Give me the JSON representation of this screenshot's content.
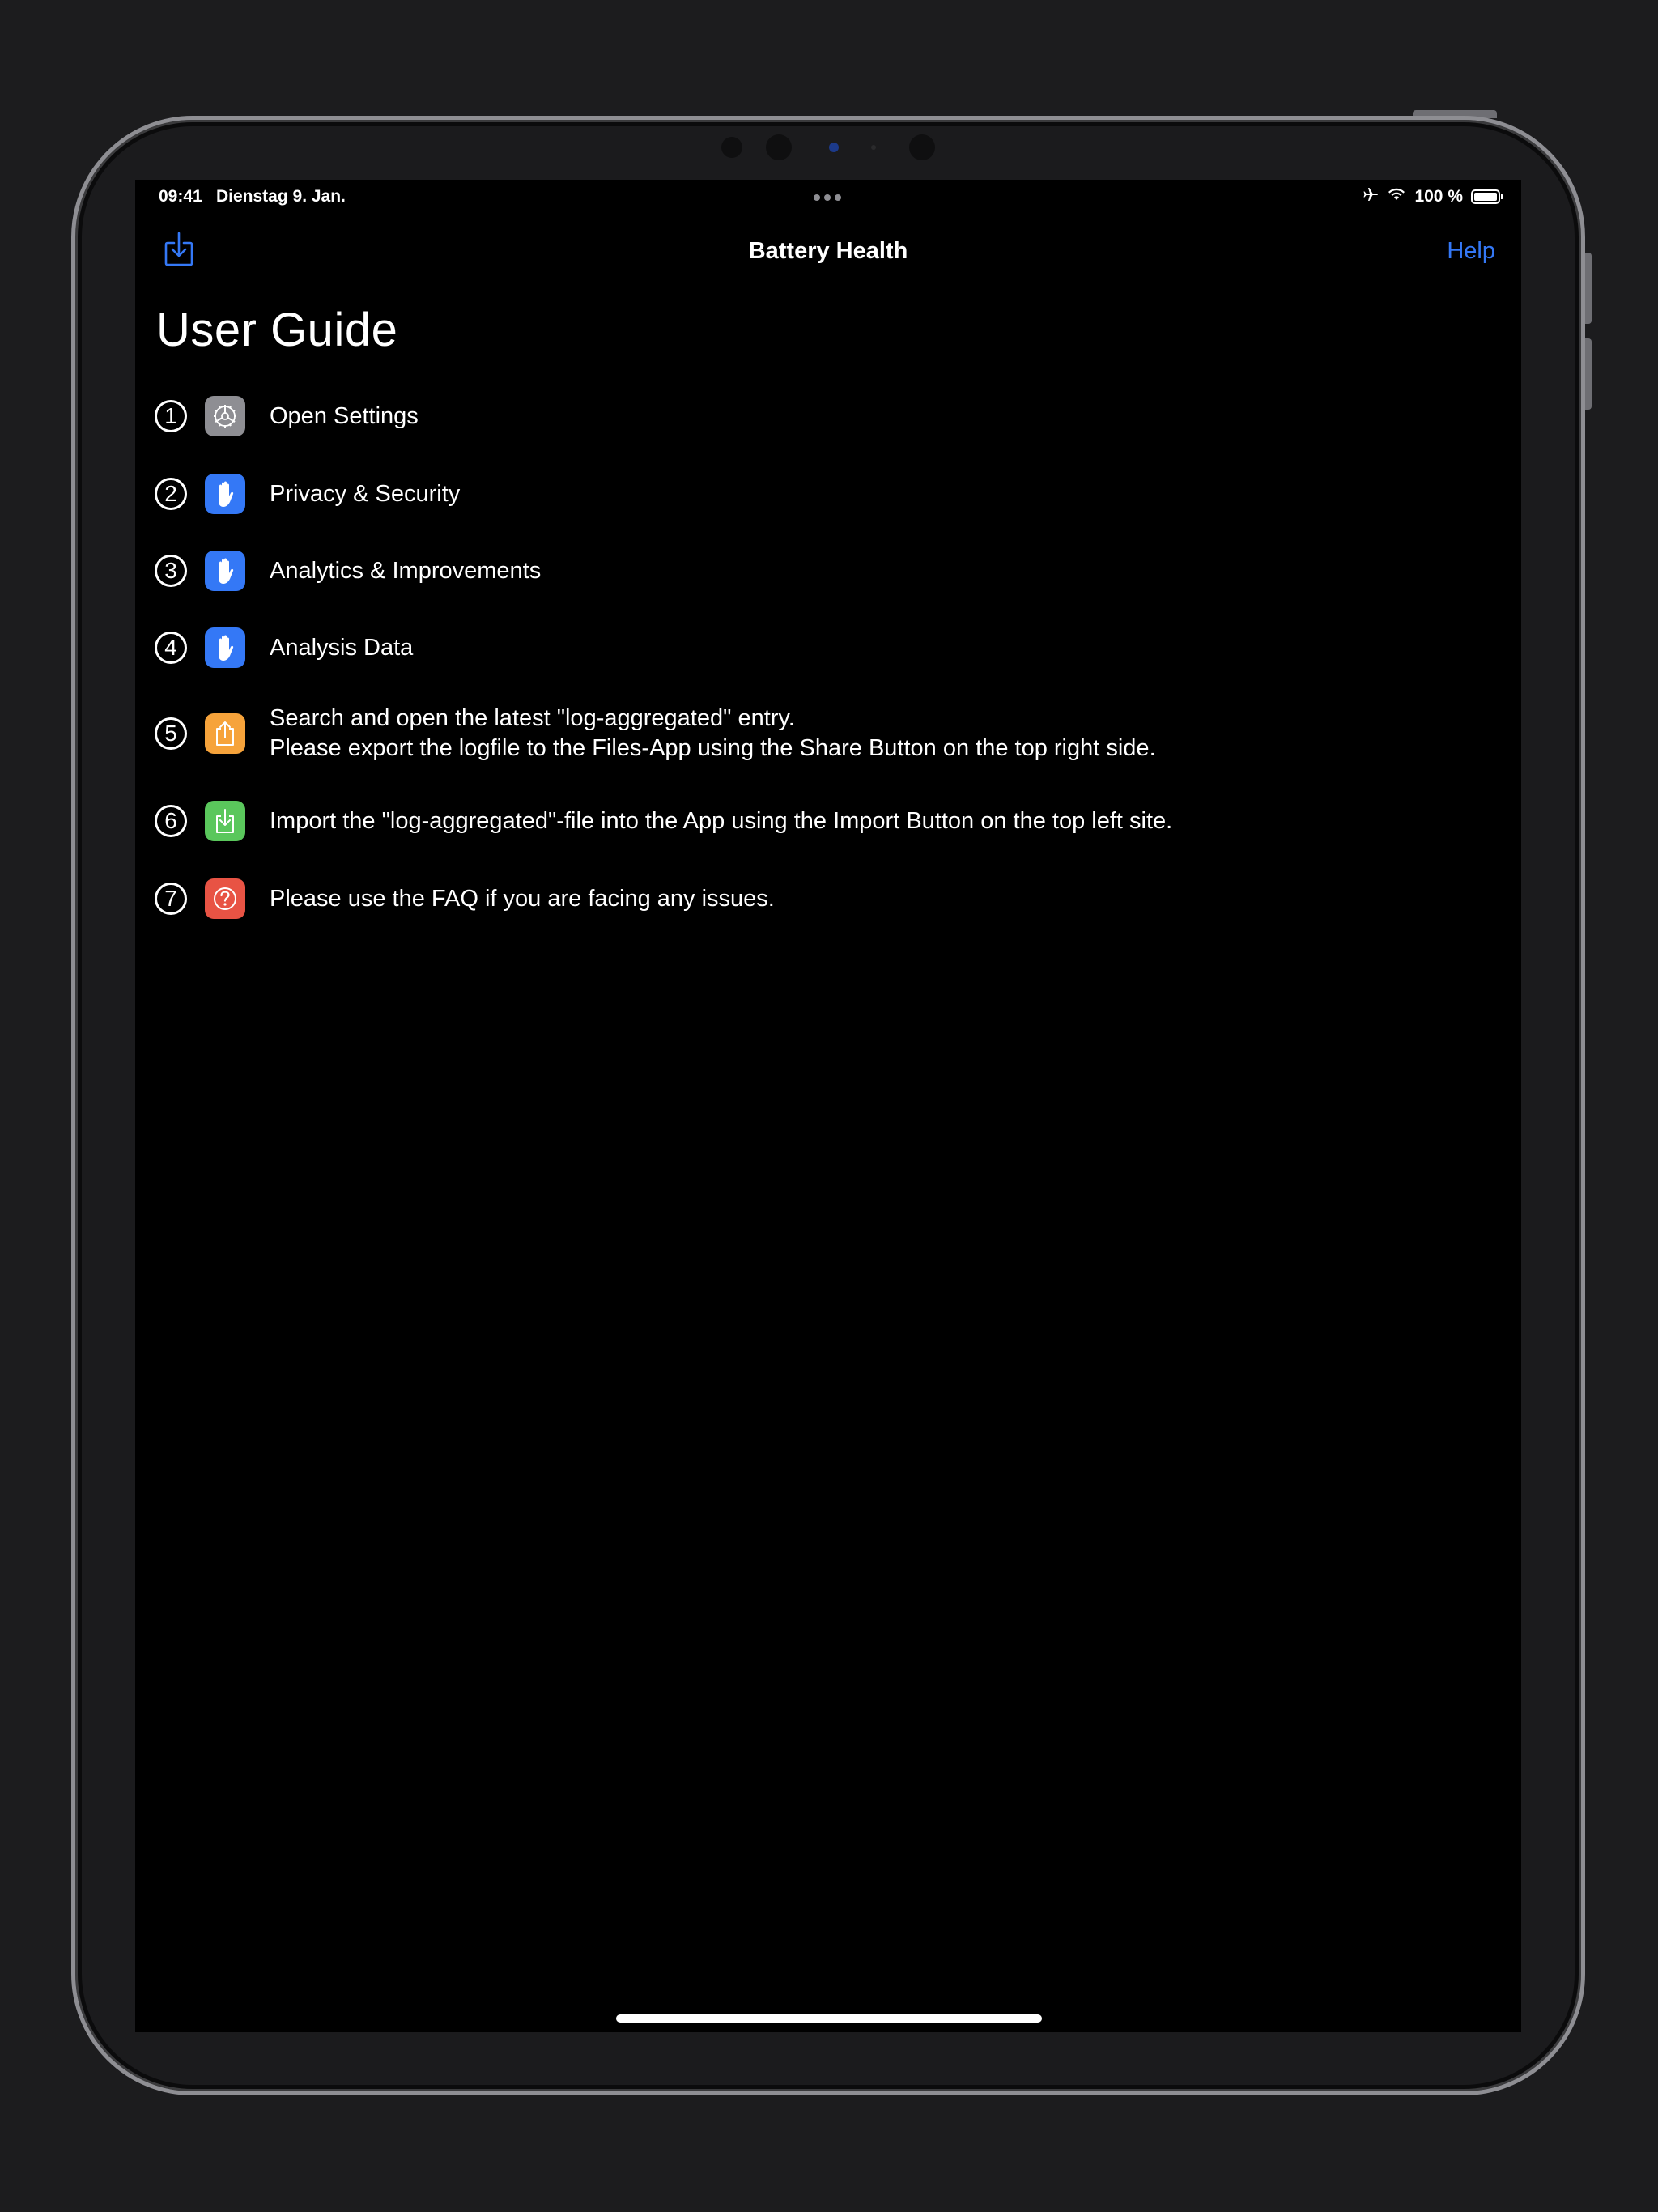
{
  "status_bar": {
    "time": "09:41",
    "date": "Dienstag 9. Jan.",
    "battery_text": "100 %",
    "battery_level": 1.0,
    "icons": [
      "airplane-icon",
      "wifi-icon",
      "battery-icon"
    ]
  },
  "nav": {
    "title": "Battery Health",
    "help_label": "Help",
    "import_icon": "import-icon",
    "accent_color": "#3478f6"
  },
  "page": {
    "title": "User Guide"
  },
  "steps": [
    {
      "number": "1",
      "icon": "gear-icon",
      "icon_bg": "#8e8e93",
      "line1": "Open Settings",
      "line2": ""
    },
    {
      "number": "2",
      "icon": "hand-icon",
      "icon_bg": "#3478f6",
      "line1": "Privacy & Security",
      "line2": ""
    },
    {
      "number": "3",
      "icon": "hand-icon",
      "icon_bg": "#3478f6",
      "line1": "Analytics & Improvements",
      "line2": ""
    },
    {
      "number": "4",
      "icon": "hand-icon",
      "icon_bg": "#3478f6",
      "line1": "Analysis Data",
      "line2": ""
    },
    {
      "number": "5",
      "icon": "share-icon",
      "icon_bg": "#f6a33b",
      "line1": "Search and open the latest \"log-aggregated\" entry.",
      "line2": "Please export the logfile to the Files-App using the Share Button on the top right side."
    },
    {
      "number": "6",
      "icon": "import-icon",
      "icon_bg": "#5ac75c",
      "line1": "Import the \"log-aggregated\"-file into the App using the Import Button on the top left site.",
      "line2": ""
    },
    {
      "number": "7",
      "icon": "question-icon",
      "icon_bg": "#e85344",
      "line1": "Please use the FAQ if you are facing any issues.",
      "line2": ""
    }
  ]
}
